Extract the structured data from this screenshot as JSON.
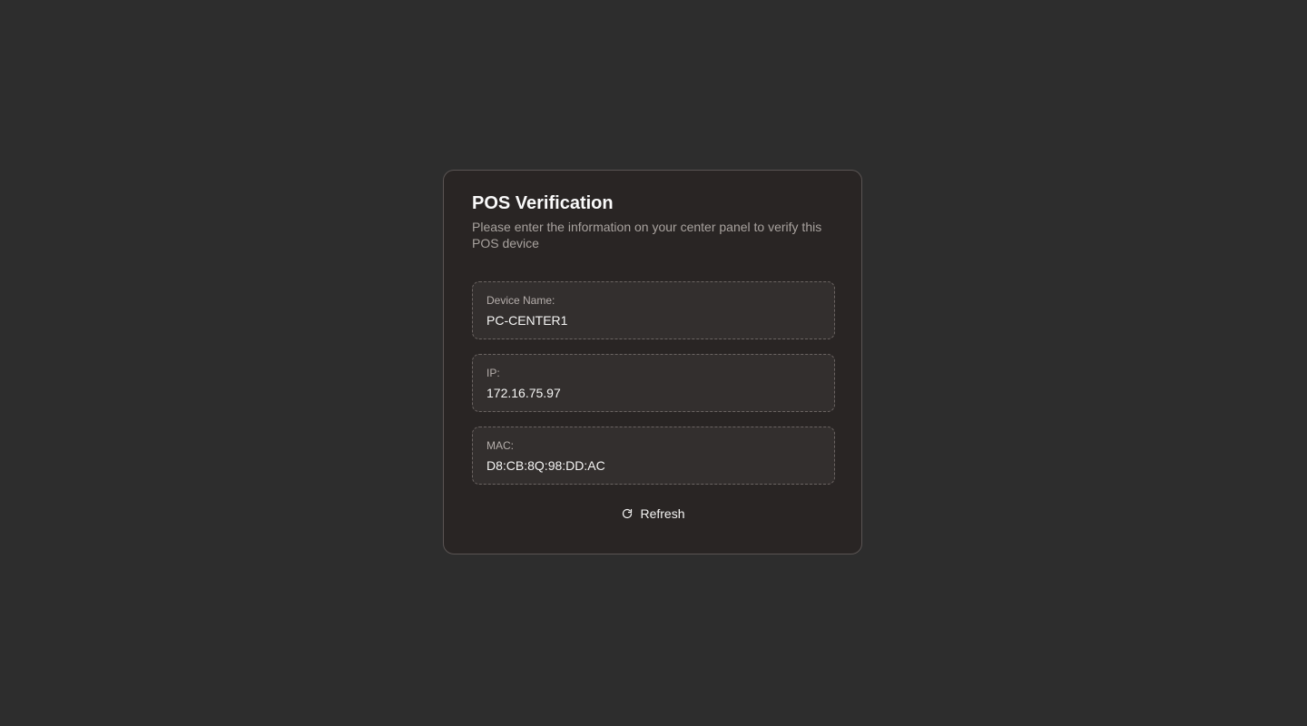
{
  "dialog": {
    "title": "POS Verification",
    "subtitle": "Please enter the information on your center panel to verify this POS device"
  },
  "fields": [
    {
      "label": "Device Name:",
      "value": "PC-CENTER1"
    },
    {
      "label": "IP:",
      "value": "172.16.75.97"
    },
    {
      "label": "MAC:",
      "value": "D8:CB:8Q:98:DD:AC"
    }
  ],
  "actions": {
    "refresh_label": "Refresh",
    "refresh_icon": "refresh-icon"
  },
  "colors": {
    "background": "#2d2d2d",
    "card": "#292524",
    "field": "#332f2e",
    "text": "#f5f5f4",
    "muted": "#a8a29e"
  }
}
